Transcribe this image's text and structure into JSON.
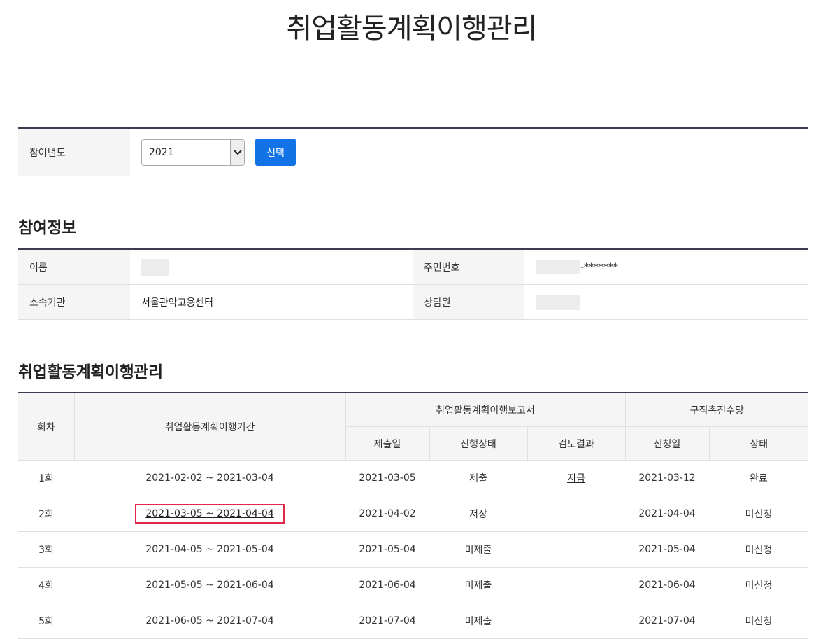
{
  "page_title": "취업활동계획이행관리",
  "year_filter": {
    "label": "참여년도",
    "selected": "2021",
    "button": "선택"
  },
  "participation": {
    "title": "참여정보",
    "name_label": "이름",
    "rrn_label": "주민번호",
    "rrn_suffix": "-*******",
    "org_label": "소속기관",
    "org_value": "서울관악고용센터",
    "counselor_label": "상담원"
  },
  "plan": {
    "title": "취업활동계획이행관리",
    "headers": {
      "round": "회차",
      "period": "취업활동계획이행기간",
      "report_group": "취업활동계획이행보고서",
      "allowance_group": "구직촉진수당",
      "submit_date": "제출일",
      "progress": "진행상태",
      "review": "검토결과",
      "apply_date": "신청일",
      "status": "상태"
    },
    "rows": [
      {
        "round": "1회",
        "period": "2021-02-02 ~ 2021-03-04",
        "submit_date": "2021-03-05",
        "progress": "제출",
        "review": "지급",
        "apply_date": "2021-03-12",
        "status": "완료"
      },
      {
        "round": "2회",
        "period": "2021-03-05 ~ 2021-04-04",
        "submit_date": "2021-04-02",
        "progress": "저장",
        "review": "",
        "apply_date": "2021-04-04",
        "status": "미신청"
      },
      {
        "round": "3회",
        "period": "2021-04-05 ~ 2021-05-04",
        "submit_date": "2021-05-04",
        "progress": "미제출",
        "review": "",
        "apply_date": "2021-05-04",
        "status": "미신청"
      },
      {
        "round": "4회",
        "period": "2021-05-05 ~ 2021-06-04",
        "submit_date": "2021-06-04",
        "progress": "미제출",
        "review": "",
        "apply_date": "2021-06-04",
        "status": "미신청"
      },
      {
        "round": "5회",
        "period": "2021-06-05 ~ 2021-07-04",
        "submit_date": "2021-07-04",
        "progress": "미제출",
        "review": "",
        "apply_date": "2021-07-04",
        "status": "미신청"
      }
    ]
  }
}
